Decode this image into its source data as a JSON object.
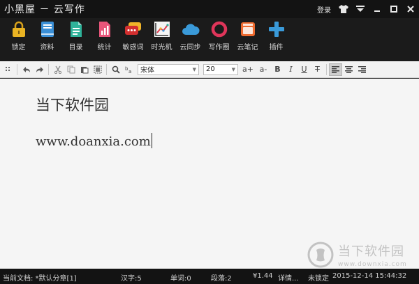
{
  "titlebar": {
    "app_name": "小黑屋 － 云写作",
    "login_label": "登录"
  },
  "toolbar": {
    "items": [
      {
        "label": "锁定",
        "icon": "lock-icon"
      },
      {
        "label": "资料",
        "icon": "book-icon"
      },
      {
        "label": "目录",
        "icon": "document-icon"
      },
      {
        "label": "统计",
        "icon": "stats-icon"
      },
      {
        "label": "敏感词",
        "icon": "chat-bubble-icon"
      },
      {
        "label": "时光机",
        "icon": "chart-icon"
      },
      {
        "label": "云同步",
        "icon": "cloud-icon"
      },
      {
        "label": "写作圈",
        "icon": "ring-icon"
      },
      {
        "label": "云笔记",
        "icon": "notebook-icon"
      },
      {
        "label": "插件",
        "icon": "plus-icon"
      }
    ]
  },
  "formatbar": {
    "font": "宋体",
    "size": "20",
    "increase_font": "a+",
    "decrease_font": "a-",
    "bold": "B",
    "italic": "I",
    "underline": "U",
    "strike": "T"
  },
  "document": {
    "line1": "当下软件园",
    "line2": "www.doanxia.com"
  },
  "watermark": {
    "text": "当下软件园",
    "url": "www.downxia.com"
  },
  "status": {
    "current_doc": "当前文档: *默认分章[1]",
    "chars": "汉字:5",
    "words": "单词:0",
    "paragraphs": "段落:2",
    "price": "¥1.44",
    "details": "详情...",
    "lock_state": "未锁定",
    "datetime": "2015-12-14 15:44:32"
  },
  "colors": {
    "title_bg": "#131313",
    "toolbar_bg": "#1b1b1b",
    "editor_bg": "#f5f5f5",
    "accent_red": "#e03a4e",
    "accent_blue": "#3a9ad9"
  }
}
